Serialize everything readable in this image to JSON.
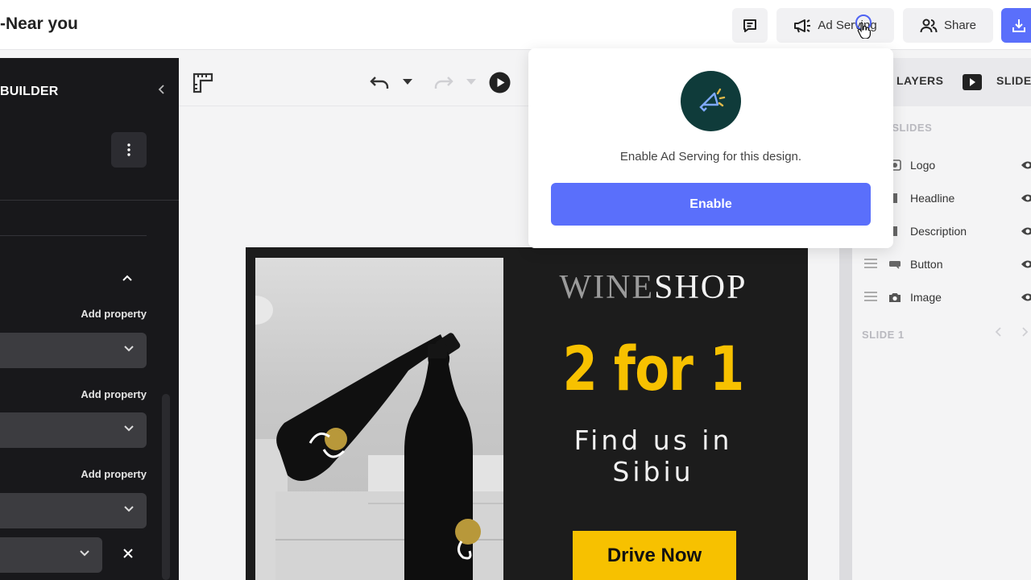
{
  "header": {
    "title": "-Near you",
    "ad_serving_label": "Ad Serving",
    "share_label": "Share",
    "icons": [
      "comment-icon",
      "megaphone-icon",
      "users-icon",
      "download-icon"
    ]
  },
  "left_panel": {
    "title": "BUILDER",
    "add_property_labels": [
      "Add property",
      "Add property",
      "Add property"
    ]
  },
  "ad": {
    "brand_a": "WINE",
    "brand_b": "SHOP",
    "promo": "2 for 1",
    "find_line1": "Find us in",
    "find_line2": "Sibiu",
    "cta": "Drive Now"
  },
  "right_panel": {
    "tabs": [
      "LAYERS",
      "SLIDE"
    ],
    "section_all": "L SLIDES",
    "layers": [
      {
        "label": "Logo",
        "icon": "image-icon"
      },
      {
        "label": "Headline",
        "icon": "text-icon"
      },
      {
        "label": "Description",
        "icon": "text-icon"
      },
      {
        "label": "Button",
        "icon": "button-icon"
      },
      {
        "label": "Image",
        "icon": "camera-icon"
      }
    ],
    "section_slide": "SLIDE 1"
  },
  "popover": {
    "text": "Enable Ad Serving for this design.",
    "button": "Enable"
  },
  "colors": {
    "accent": "#5a6ffb",
    "promo_yellow": "#f7c100",
    "dark_panel": "#18181b"
  }
}
